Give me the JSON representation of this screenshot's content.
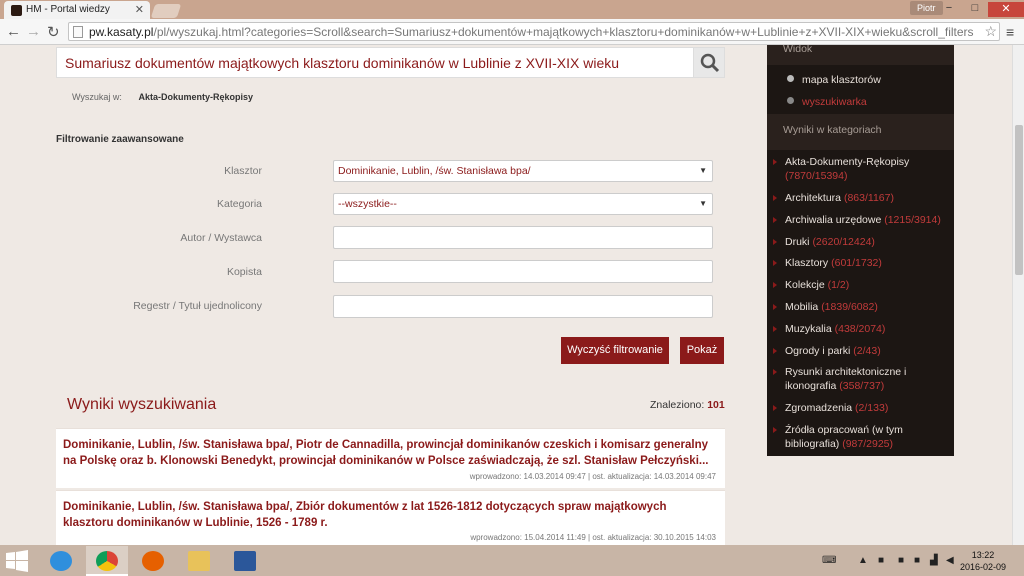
{
  "browser": {
    "tab_title": "HM - Portal wiedzy",
    "profile": "Piotr",
    "url_domain": "pw.kasaty.pl",
    "url_path": "/pl/wyszukaj.html?categories=Scroll&search=Sumariusz+dokumentów+majątkowych+klasztoru+dominikanów+w+Lublinie+z+XVII-XIX+wieku&scroll_filters"
  },
  "search": {
    "query": "Sumariusz dokumentów majątkowych klasztoru dominikanów w Lublinie z XVII-XIX wieku",
    "scope_label": "Wyszukaj w:",
    "scope_value": "Akta-Dokumenty-Rękopisy"
  },
  "filters": {
    "title": "Filtrowanie zaawansowane",
    "fields": [
      {
        "label": "Klasztor",
        "value": "Dominikanie, Lublin, /św. Stanisława bpa/"
      },
      {
        "label": "Kategoria",
        "value": "--wszystkie--"
      },
      {
        "label": "Autor / Wystawca",
        "value": ""
      },
      {
        "label": "Kopista",
        "value": ""
      },
      {
        "label": "Regestr / Tytuł ujednolicony",
        "value": ""
      }
    ],
    "clear_label": "Wyczyść filtrowanie",
    "show_label": "Pokaż"
  },
  "results": {
    "title": "Wyniki wyszukiwania",
    "found_label": "Znaleziono:",
    "found_count": "101",
    "items": [
      {
        "title": "Dominikanie, Lublin, /św. Stanisława bpa/, Piotr de Cannadilla, prowincjał dominikanów czeskich i komisarz generalny na Polskę oraz b. Klonowski Benedykt, prowincjał dominikanów w Polsce zaświadczają, że szl. Stanisław Pełczyński...",
        "meta": "wprowadzono: 14.03.2014 09:47 | ost. aktualizacja: 14.03.2014 09:47"
      },
      {
        "title": "Dominikanie, Lublin, /św. Stanisława bpa/, Zbiór dokumentów z lat 1526-1812 dotyczących spraw majątkowych klasztoru dominikanów w Lublinie, 1526 - 1789 r.",
        "meta": "wprowadzono: 15.04.2014 11:49 | ost. aktualizacja: 30.10.2015 14:03"
      }
    ]
  },
  "sidebar": {
    "view_title": "Widok",
    "view_links": [
      {
        "label": "mapa klasztorów",
        "active": false
      },
      {
        "label": "wyszukiwarka",
        "active": true
      }
    ],
    "categories_title": "Wyniki w kategoriach",
    "categories": [
      {
        "name": "Akta-Dokumenty-Rękopisy",
        "count": "(7870/15394)"
      },
      {
        "name": "Architektura",
        "count": "(863/1167)"
      },
      {
        "name": "Archiwalia urzędowe",
        "count": "(1215/3914)"
      },
      {
        "name": "Druki",
        "count": "(2620/12424)"
      },
      {
        "name": "Klasztory",
        "count": "(601/1732)"
      },
      {
        "name": "Kolekcje",
        "count": "(1/2)"
      },
      {
        "name": "Mobilia",
        "count": "(1839/6082)"
      },
      {
        "name": "Muzykalia",
        "count": "(438/2074)"
      },
      {
        "name": "Ogrody i parki",
        "count": "(2/43)"
      },
      {
        "name": "Rysunki architektoniczne i ikonografia",
        "count": "(358/737)"
      },
      {
        "name": "Zgromadzenia",
        "count": "(2/133)"
      },
      {
        "name": "Źródła opracowań (w tym bibliografia)",
        "count": "(987/2925)"
      }
    ]
  },
  "taskbar": {
    "time": "13:22",
    "date": "2016-02-09"
  },
  "colors": {
    "accent": "#8b1a1a",
    "sidebar_bg": "#1c1613",
    "page_bg": "#efe9e4"
  }
}
